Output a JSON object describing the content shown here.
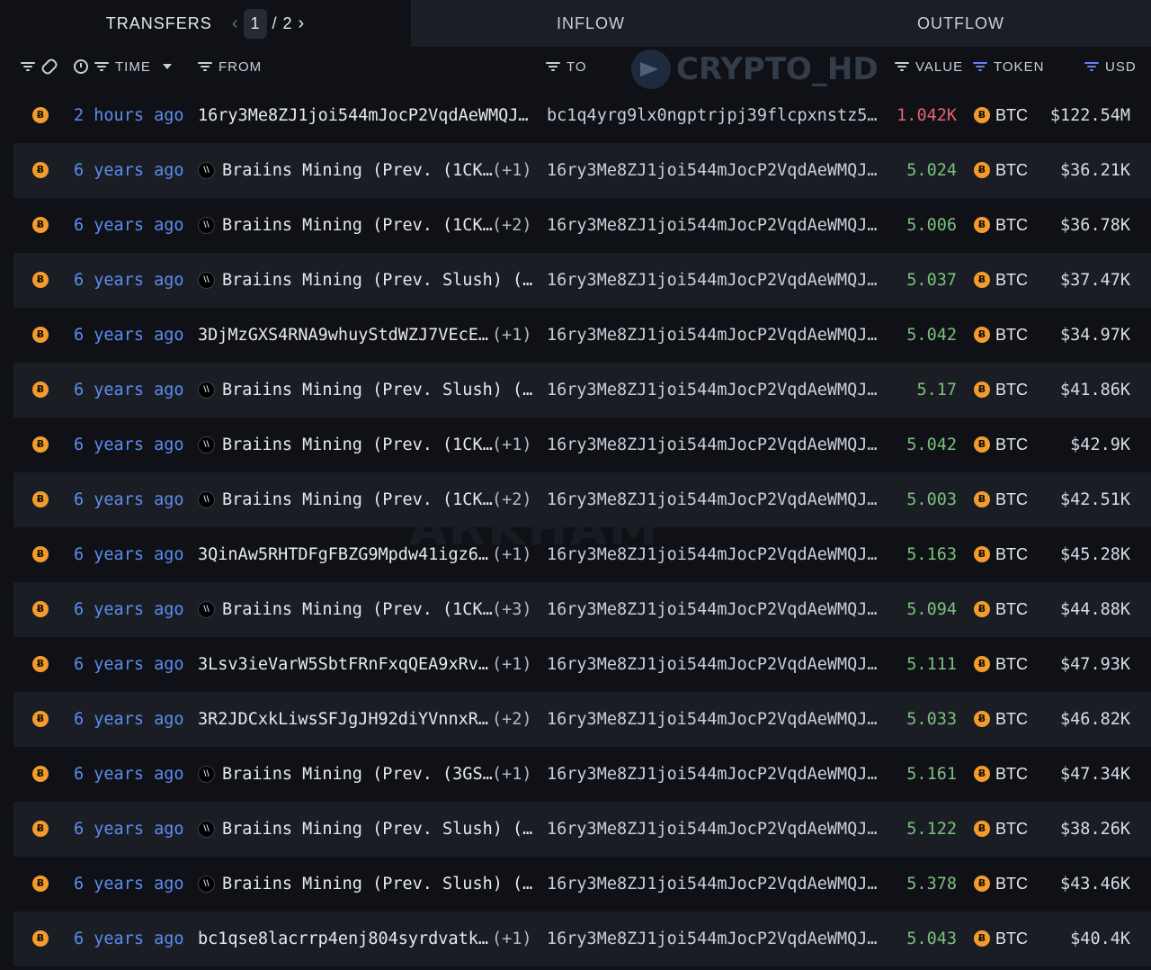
{
  "tabs": {
    "transfers": "TRANSFERS",
    "inflow": "INFLOW",
    "outflow": "OUTFLOW",
    "page_current": "1",
    "page_sep": "/",
    "page_total": "2"
  },
  "headers": {
    "time": "TIME",
    "from": "FROM",
    "to": "TO",
    "value": "VALUE",
    "token": "TOKEN",
    "usd": "USD"
  },
  "watermarks": {
    "top": "CRYPTO_HD",
    "mid": "ARKHAM"
  },
  "colors": {
    "time_link": "#5b8def",
    "value_positive": "#7ac07d",
    "value_negative": "#e8606b",
    "btc": "#f39c2c",
    "filter_accent": "#6c7df5"
  },
  "icons": {
    "token": "bitcoin-icon",
    "entity": "braiins-logo-icon"
  },
  "rows": [
    {
      "time": "2 hours ago",
      "from": "16ry3Me8ZJ1joi544mJocP2VqdAeWMQJ…",
      "from_entity": false,
      "from_extra": "",
      "to": "bc1q4yrg9lx0ngptrjpj39flcpxnstz5…",
      "value": "1.042K",
      "value_color": "red",
      "token": "BTC",
      "usd": "$122.54M"
    },
    {
      "time": "6 years ago",
      "from": "Braiins Mining (Prev. (1CK…",
      "from_entity": true,
      "from_extra": "(+1)",
      "to": "16ry3Me8ZJ1joi544mJocP2VqdAeWMQJ…",
      "value": "5.024",
      "value_color": "green",
      "token": "BTC",
      "usd": "$36.21K"
    },
    {
      "time": "6 years ago",
      "from": "Braiins Mining (Prev. (1CK…",
      "from_entity": true,
      "from_extra": "(+2)",
      "to": "16ry3Me8ZJ1joi544mJocP2VqdAeWMQJ…",
      "value": "5.006",
      "value_color": "green",
      "token": "BTC",
      "usd": "$36.78K"
    },
    {
      "time": "6 years ago",
      "from": "Braiins Mining (Prev. Slush) (…",
      "from_entity": true,
      "from_extra": "",
      "to": "16ry3Me8ZJ1joi544mJocP2VqdAeWMQJ…",
      "value": "5.037",
      "value_color": "green",
      "token": "BTC",
      "usd": "$37.47K"
    },
    {
      "time": "6 years ago",
      "from": "3DjMzGXS4RNA9whuyStdWZJ7VEcE…",
      "from_entity": false,
      "from_extra": "(+1)",
      "to": "16ry3Me8ZJ1joi544mJocP2VqdAeWMQJ…",
      "value": "5.042",
      "value_color": "green",
      "token": "BTC",
      "usd": "$34.97K"
    },
    {
      "time": "6 years ago",
      "from": "Braiins Mining (Prev. Slush) (…",
      "from_entity": true,
      "from_extra": "",
      "to": "16ry3Me8ZJ1joi544mJocP2VqdAeWMQJ…",
      "value": "5.17",
      "value_color": "green",
      "token": "BTC",
      "usd": "$41.86K"
    },
    {
      "time": "6 years ago",
      "from": "Braiins Mining (Prev. (1CK…",
      "from_entity": true,
      "from_extra": "(+1)",
      "to": "16ry3Me8ZJ1joi544mJocP2VqdAeWMQJ…",
      "value": "5.042",
      "value_color": "green",
      "token": "BTC",
      "usd": "$42.9K"
    },
    {
      "time": "6 years ago",
      "from": "Braiins Mining (Prev. (1CK…",
      "from_entity": true,
      "from_extra": "(+2)",
      "to": "16ry3Me8ZJ1joi544mJocP2VqdAeWMQJ…",
      "value": "5.003",
      "value_color": "green",
      "token": "BTC",
      "usd": "$42.51K"
    },
    {
      "time": "6 years ago",
      "from": "3QinAw5RHTDFgFBZG9Mpdw41igz6…",
      "from_entity": false,
      "from_extra": "(+1)",
      "to": "16ry3Me8ZJ1joi544mJocP2VqdAeWMQJ…",
      "value": "5.163",
      "value_color": "green",
      "token": "BTC",
      "usd": "$45.28K"
    },
    {
      "time": "6 years ago",
      "from": "Braiins Mining (Prev. (1CK…",
      "from_entity": true,
      "from_extra": "(+3)",
      "to": "16ry3Me8ZJ1joi544mJocP2VqdAeWMQJ…",
      "value": "5.094",
      "value_color": "green",
      "token": "BTC",
      "usd": "$44.88K"
    },
    {
      "time": "6 years ago",
      "from": "3Lsv3ieVarW5SbtFRnFxqQEA9xRv…",
      "from_entity": false,
      "from_extra": "(+1)",
      "to": "16ry3Me8ZJ1joi544mJocP2VqdAeWMQJ…",
      "value": "5.111",
      "value_color": "green",
      "token": "BTC",
      "usd": "$47.93K"
    },
    {
      "time": "6 years ago",
      "from": "3R2JDCxkLiwsSFJgJH92diYVnnxR…",
      "from_entity": false,
      "from_extra": "(+2)",
      "to": "16ry3Me8ZJ1joi544mJocP2VqdAeWMQJ…",
      "value": "5.033",
      "value_color": "green",
      "token": "BTC",
      "usd": "$46.82K"
    },
    {
      "time": "6 years ago",
      "from": "Braiins Mining (Prev. (3GS…",
      "from_entity": true,
      "from_extra": "(+1)",
      "to": "16ry3Me8ZJ1joi544mJocP2VqdAeWMQJ…",
      "value": "5.161",
      "value_color": "green",
      "token": "BTC",
      "usd": "$47.34K"
    },
    {
      "time": "6 years ago",
      "from": "Braiins Mining (Prev. Slush) (…",
      "from_entity": true,
      "from_extra": "",
      "to": "16ry3Me8ZJ1joi544mJocP2VqdAeWMQJ…",
      "value": "5.122",
      "value_color": "green",
      "token": "BTC",
      "usd": "$38.26K"
    },
    {
      "time": "6 years ago",
      "from": "Braiins Mining (Prev. Slush) (…",
      "from_entity": true,
      "from_extra": "",
      "to": "16ry3Me8ZJ1joi544mJocP2VqdAeWMQJ…",
      "value": "5.378",
      "value_color": "green",
      "token": "BTC",
      "usd": "$43.46K"
    },
    {
      "time": "6 years ago",
      "from": "bc1qse8lacrrp4enj804syrdvatk…",
      "from_entity": false,
      "from_extra": "(+1)",
      "to": "16ry3Me8ZJ1joi544mJocP2VqdAeWMQJ…",
      "value": "5.043",
      "value_color": "green",
      "token": "BTC",
      "usd": "$40.4K"
    }
  ]
}
